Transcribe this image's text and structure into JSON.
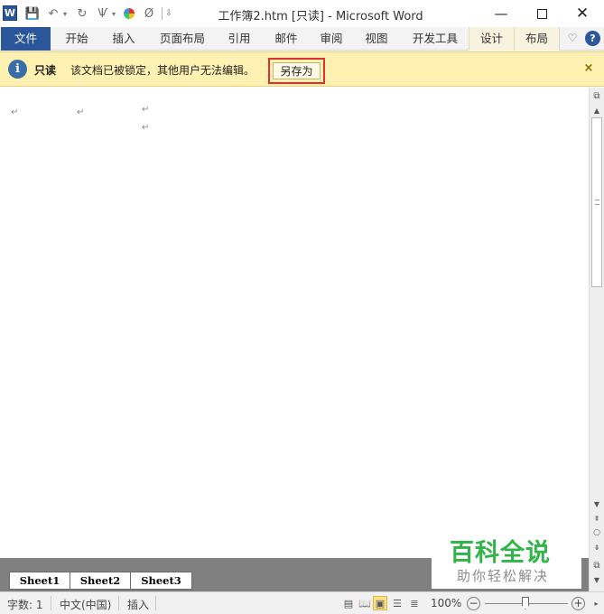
{
  "window": {
    "title": "工作簿2.htm [只读]  -  Microsoft Word",
    "app_logo": "W",
    "minimize_glyph": "—",
    "close_glyph": "✕"
  },
  "quick_access": {
    "icons": [
      "word-logo-icon",
      "save-icon",
      "undo-icon",
      "redo-icon",
      "format-painter-icon",
      "color-wheel-icon",
      "eraser-icon",
      "customize-icon"
    ],
    "glyphs": {
      "save": "💾",
      "undo": "↶",
      "dropdown": "▾",
      "redo": "↻",
      "format": "Ѱ",
      "eraser": "Ø",
      "customize": "⇩"
    }
  },
  "ribbon": {
    "tabs": [
      {
        "label": "文件"
      },
      {
        "label": "开始"
      },
      {
        "label": "插入"
      },
      {
        "label": "页面布局"
      },
      {
        "label": "引用"
      },
      {
        "label": "邮件"
      },
      {
        "label": "审阅"
      },
      {
        "label": "视图"
      },
      {
        "label": "开发工具"
      },
      {
        "label": "设计"
      },
      {
        "label": "布局"
      }
    ],
    "collapse_glyph": "♡",
    "help_glyph": "?",
    "colors": {
      "file_tab": "#2b579a",
      "context_tab": "#f7f3df"
    }
  },
  "message_bar": {
    "icon_glyph": "i",
    "title": "只读",
    "text": "该文档已被锁定，其他用户无法编辑。",
    "button_label": "另存为",
    "close_glyph": "×",
    "colors": {
      "background": "#fff1b1",
      "highlight_border": "#e0302e"
    }
  },
  "document": {
    "paragraph_mark": "↵"
  },
  "scrollbar": {
    "glyphs": {
      "ruler": "⧉",
      "up": "▲",
      "down": "▼",
      "prev": "⇞",
      "browse": "○",
      "next": "⇟",
      "split": "⧉",
      "small": "▼"
    }
  },
  "sheets": {
    "tabs": [
      "Sheet1",
      "Sheet2",
      "Sheet3"
    ]
  },
  "watermark": {
    "title": "百科全说",
    "subtitle": "助你轻松解决",
    "color": "#2fb548"
  },
  "status": {
    "word_count": "字数: 1",
    "language": "中文(中国)",
    "mode": "插入",
    "zoom": "100%",
    "zoom_out_glyph": "−",
    "zoom_in_glyph": "+",
    "view_glyphs": {
      "print": "▤",
      "reading": "📖",
      "web": "▣",
      "outline": "☰",
      "draft": "≣"
    },
    "right_arrow_glyph": "▸"
  }
}
